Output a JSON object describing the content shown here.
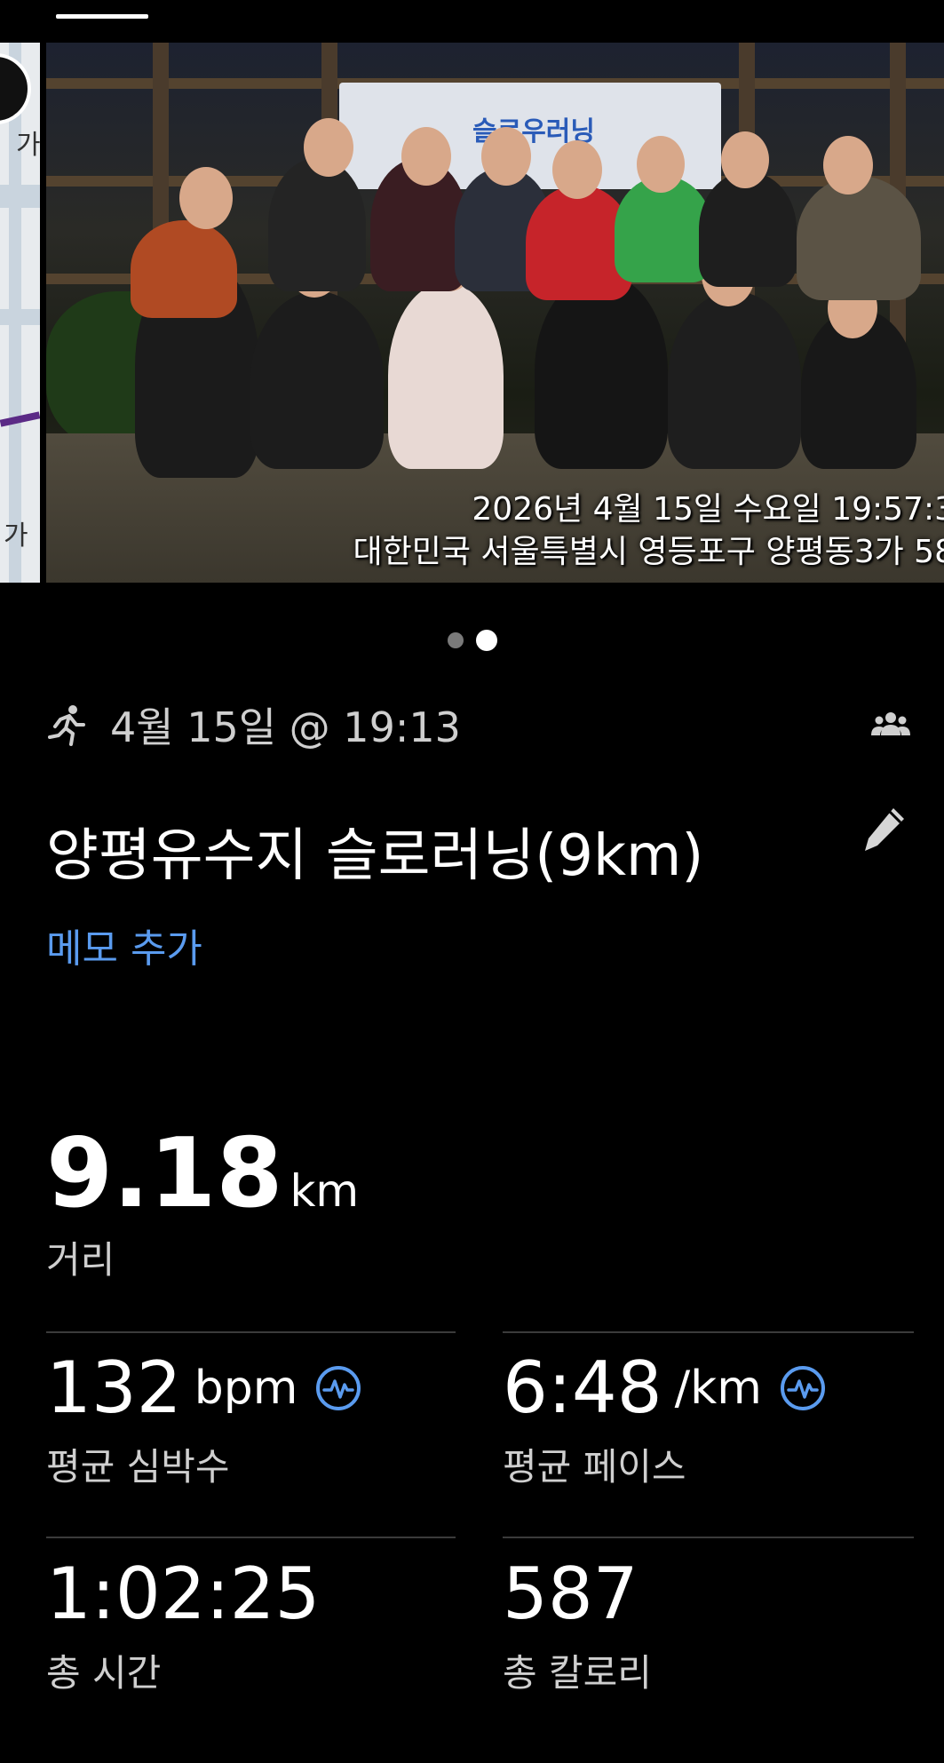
{
  "photo": {
    "stamp_line1": "2026년 4월 15일 수요일 19:57:3",
    "stamp_line2": "대한민국 서울특별시 영등포구 양평동3가 58",
    "banner_text": "슬로우러닝"
  },
  "map": {
    "label_top": "가",
    "label_bottom": "가"
  },
  "pager": {
    "count": 2,
    "active_index": 1
  },
  "activity": {
    "icon": "running-icon",
    "date_time": "4월 15일 @ 19:13",
    "title": "양평유수지 슬로러닝(9km)",
    "memo_link": "메모 추가"
  },
  "distance": {
    "value": "9.18",
    "unit": "km",
    "label": "거리"
  },
  "stats": [
    {
      "value": "132",
      "unit": "bpm",
      "label": "평균 심박수",
      "icon": "heart-rate-icon"
    },
    {
      "value": "6:48",
      "unit": "/km",
      "label": "평균 페이스",
      "icon": "heart-rate-icon"
    },
    {
      "value": "1:02:25",
      "unit": "",
      "label": "총 시간"
    },
    {
      "value": "587",
      "unit": "",
      "label": "총 칼로리"
    }
  ],
  "colors": {
    "accent_link": "#5a9bef",
    "background": "#000000",
    "label_text": "#cfcfcf"
  }
}
